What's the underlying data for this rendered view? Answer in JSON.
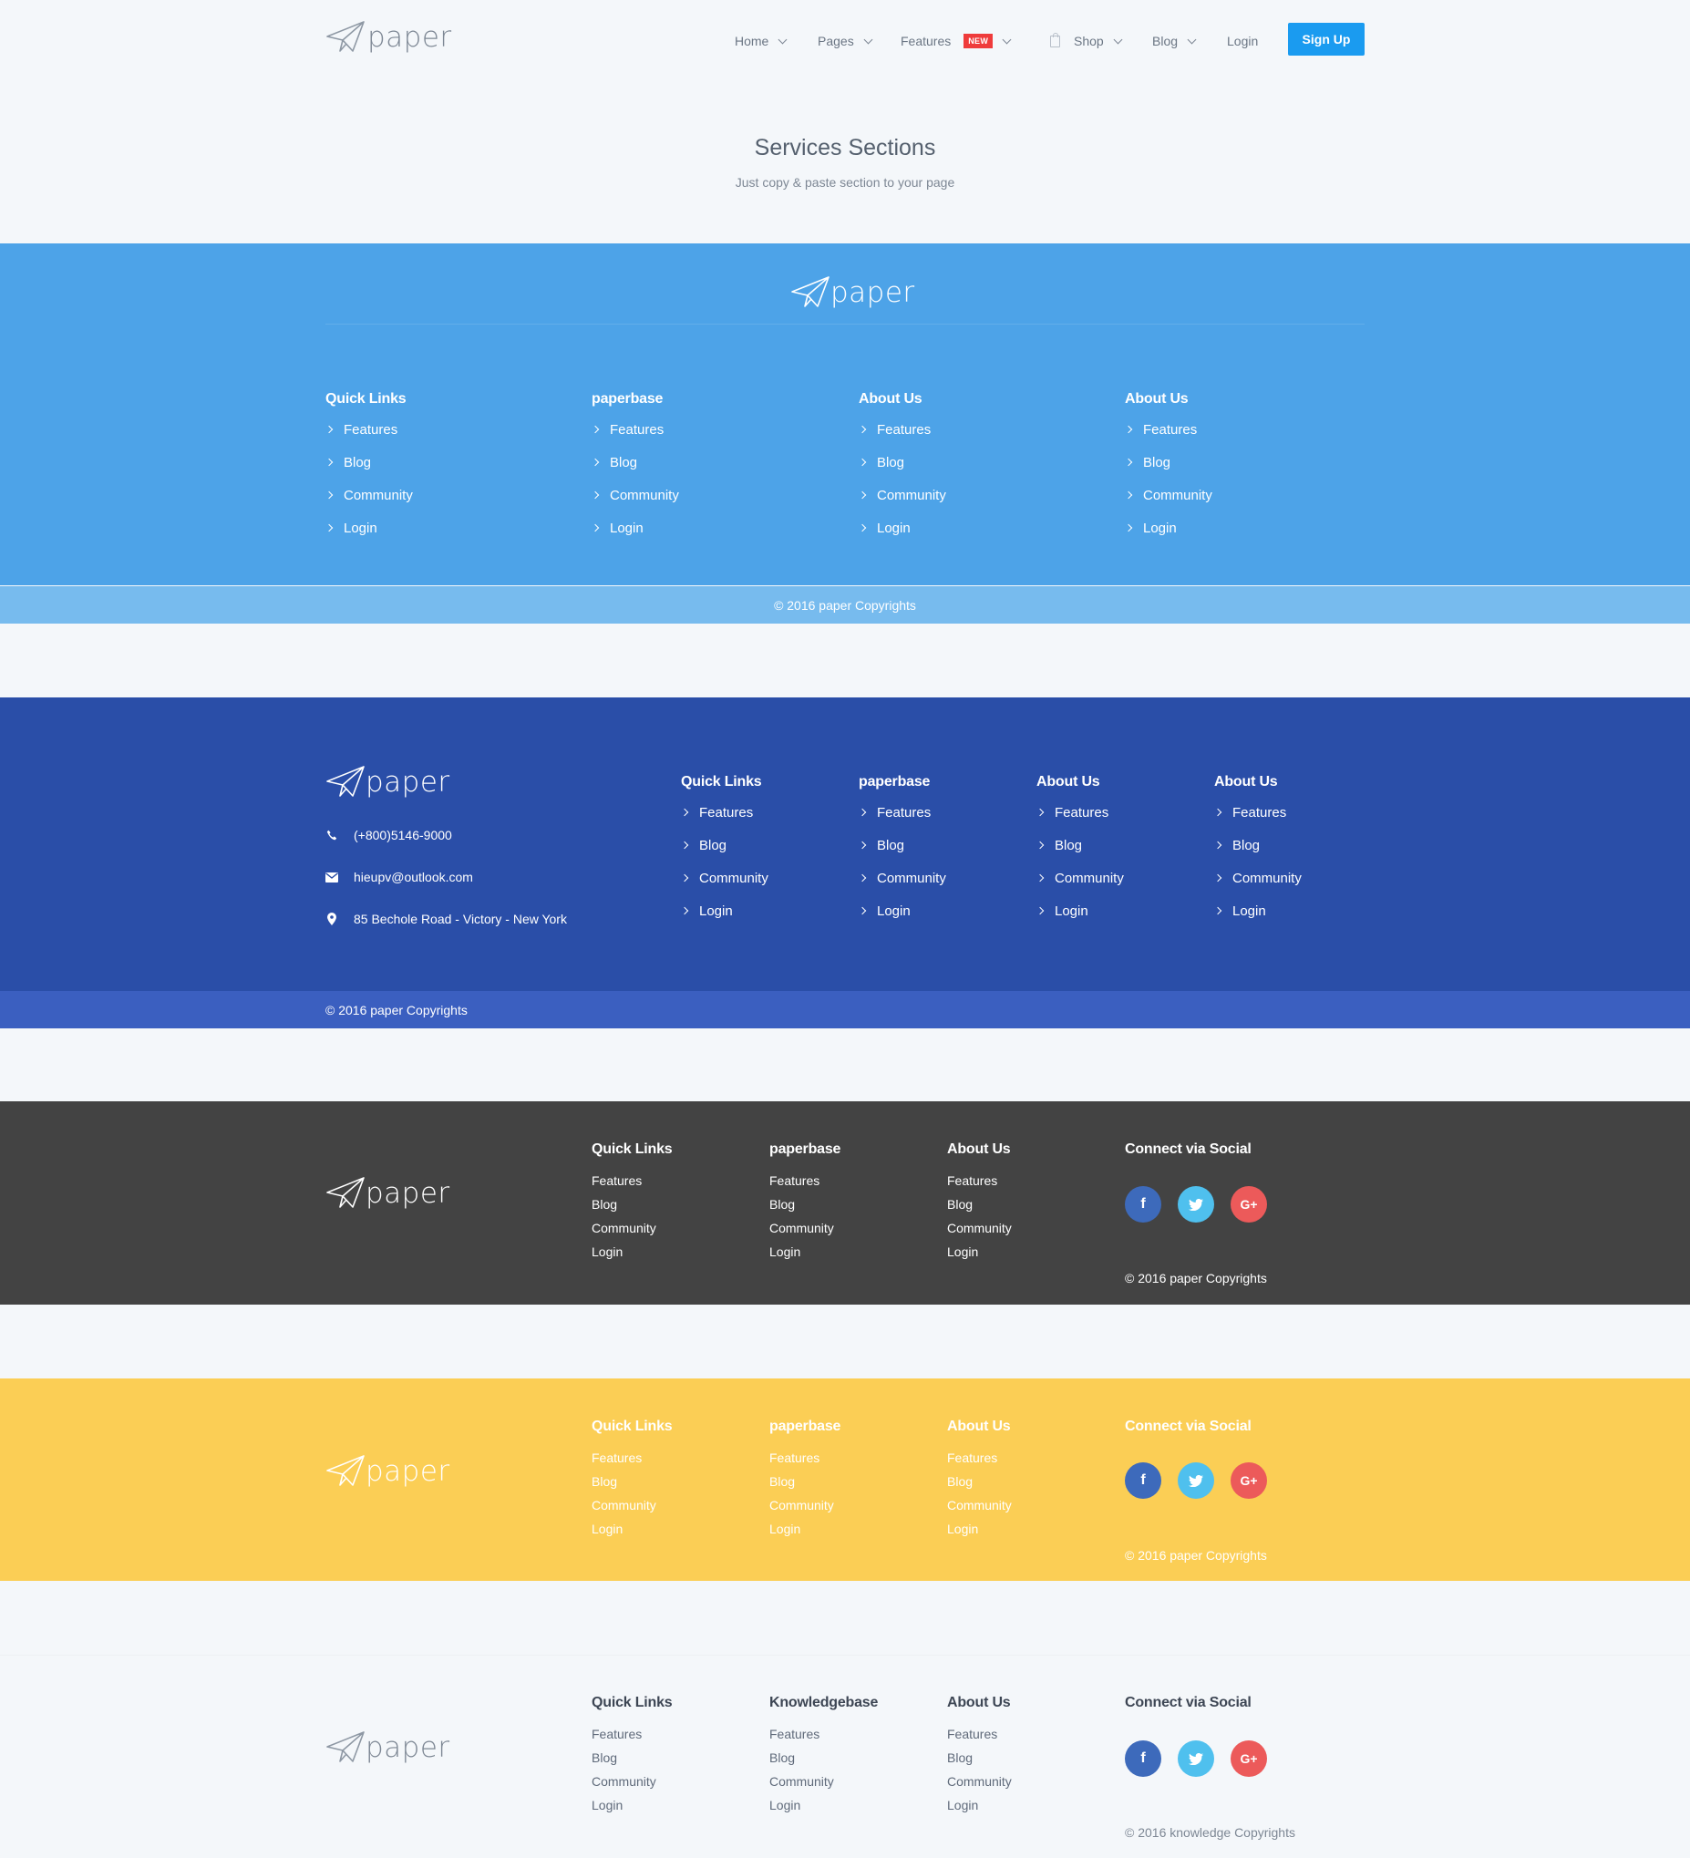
{
  "header": {
    "logo_text": "paper",
    "nav": [
      {
        "label": "Home",
        "has_caret": true
      },
      {
        "label": "Pages",
        "has_caret": true
      },
      {
        "label": "Features",
        "badge": "NEW",
        "has_caret": true
      },
      {
        "label": "Shop",
        "icon": "bag-icon",
        "has_caret": true
      },
      {
        "label": "Blog",
        "has_caret": true
      },
      {
        "label": "Login",
        "has_caret": false
      }
    ],
    "signup_label": "Sign Up"
  },
  "hero": {
    "title": "Services Sections",
    "subtitle": "Just copy & paste section to your page"
  },
  "footer1": {
    "logo_text": "paper",
    "columns": [
      {
        "title": "Quick Links",
        "links": [
          "Features",
          "Blog",
          "Community",
          "Login"
        ]
      },
      {
        "title": "paperbase",
        "links": [
          "Features",
          "Blog",
          "Community",
          "Login"
        ]
      },
      {
        "title": "About Us",
        "links": [
          "Features",
          "Blog",
          "Community",
          "Login"
        ]
      },
      {
        "title": "About Us",
        "links": [
          "Features",
          "Blog",
          "Community",
          "Login"
        ]
      }
    ],
    "copyright": "© 2016 paper Copyrights",
    "colors": {
      "bg": "#4da3e8",
      "copy_bg": "#77bbee"
    }
  },
  "footer2": {
    "logo_text": "paper",
    "phone": "(+800)5146-9000",
    "email": "hieupv@outlook.com",
    "address": "85 Bechole Road - Victory - New York",
    "columns": [
      {
        "title": "Quick Links",
        "links": [
          "Features",
          "Blog",
          "Community",
          "Login"
        ]
      },
      {
        "title": "paperbase",
        "links": [
          "Features",
          "Blog",
          "Community",
          "Login"
        ]
      },
      {
        "title": "About Us",
        "links": [
          "Features",
          "Blog",
          "Community",
          "Login"
        ]
      },
      {
        "title": "About Us",
        "links": [
          "Features",
          "Blog",
          "Community",
          "Login"
        ]
      }
    ],
    "copyright": "© 2016 paper Copyrights",
    "colors": {
      "bg": "#2a4ea8",
      "copy_bg": "#3b5fc0"
    }
  },
  "footer3": {
    "logo_text": "paper",
    "columns": [
      {
        "title": "Quick Links",
        "links": [
          "Features",
          "Blog",
          "Community",
          "Login"
        ]
      },
      {
        "title": "paperbase",
        "links": [
          "Features",
          "Blog",
          "Community",
          "Login"
        ]
      },
      {
        "title": "About Us",
        "links": [
          "Features",
          "Blog",
          "Community",
          "Login"
        ]
      }
    ],
    "social_title": "Connect via Social",
    "social": [
      {
        "icon": "facebook-icon",
        "glyph": "f"
      },
      {
        "icon": "twitter-icon",
        "glyph": "🐦"
      },
      {
        "icon": "google-plus-icon",
        "glyph": "G+"
      }
    ],
    "copyright": "© 2016 paper Copyrights",
    "colors": {
      "bg": "#434343"
    }
  },
  "footer4": {
    "logo_text": "paper",
    "columns": [
      {
        "title": "Quick Links",
        "links": [
          "Features",
          "Blog",
          "Community",
          "Login"
        ]
      },
      {
        "title": "paperbase",
        "links": [
          "Features",
          "Blog",
          "Community",
          "Login"
        ]
      },
      {
        "title": "About Us",
        "links": [
          "Features",
          "Blog",
          "Community",
          "Login"
        ]
      }
    ],
    "social_title": "Connect via Social",
    "copyright": "© 2016 paper Copyrights",
    "colors": {
      "bg": "#fbce55"
    }
  },
  "footer5": {
    "logo_text": "paper",
    "columns": [
      {
        "title": "Quick Links",
        "links": [
          "Features",
          "Blog",
          "Community",
          "Login"
        ]
      },
      {
        "title": "Knowledgebase",
        "links": [
          "Features",
          "Blog",
          "Community",
          "Login"
        ]
      },
      {
        "title": "About Us",
        "links": [
          "Features",
          "Blog",
          "Community",
          "Login"
        ]
      }
    ],
    "social_title": "Connect via Social",
    "copyright": "© 2016 knowledge Copyrights",
    "colors": {
      "bg": "#f4f7fa"
    }
  }
}
